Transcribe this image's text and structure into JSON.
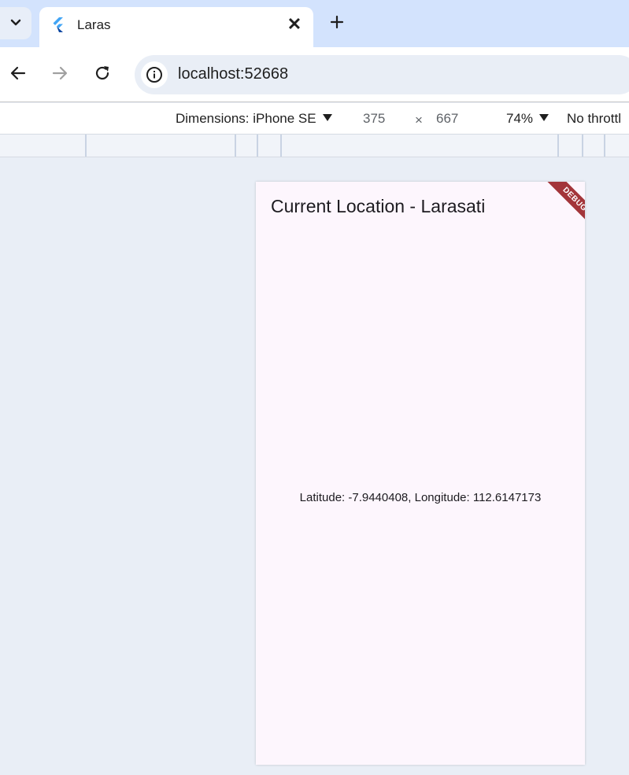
{
  "browser": {
    "tab": {
      "title": "Laras",
      "close_glyph": "✕",
      "favicon": "flutter-icon"
    },
    "new_tab_icon": "plus-icon",
    "toolbar": {
      "url": "localhost:52668"
    }
  },
  "device_toolbar": {
    "dimensions_label": "Dimensions: iPhone SE",
    "width": "375",
    "times": "×",
    "height": "667",
    "zoom": "74%",
    "throttle": "No throttl"
  },
  "app": {
    "title": "Current Location - Larasati",
    "location_text": "Latitude: -7.9440408, Longitude: 112.6147173",
    "debug_banner": "DEBUG",
    "background_color": "#fdf6fd"
  },
  "colors": {
    "tab_strip": "#d3e3fd",
    "page_background": "#e9eef6",
    "debug_banner": "#a3353a"
  }
}
